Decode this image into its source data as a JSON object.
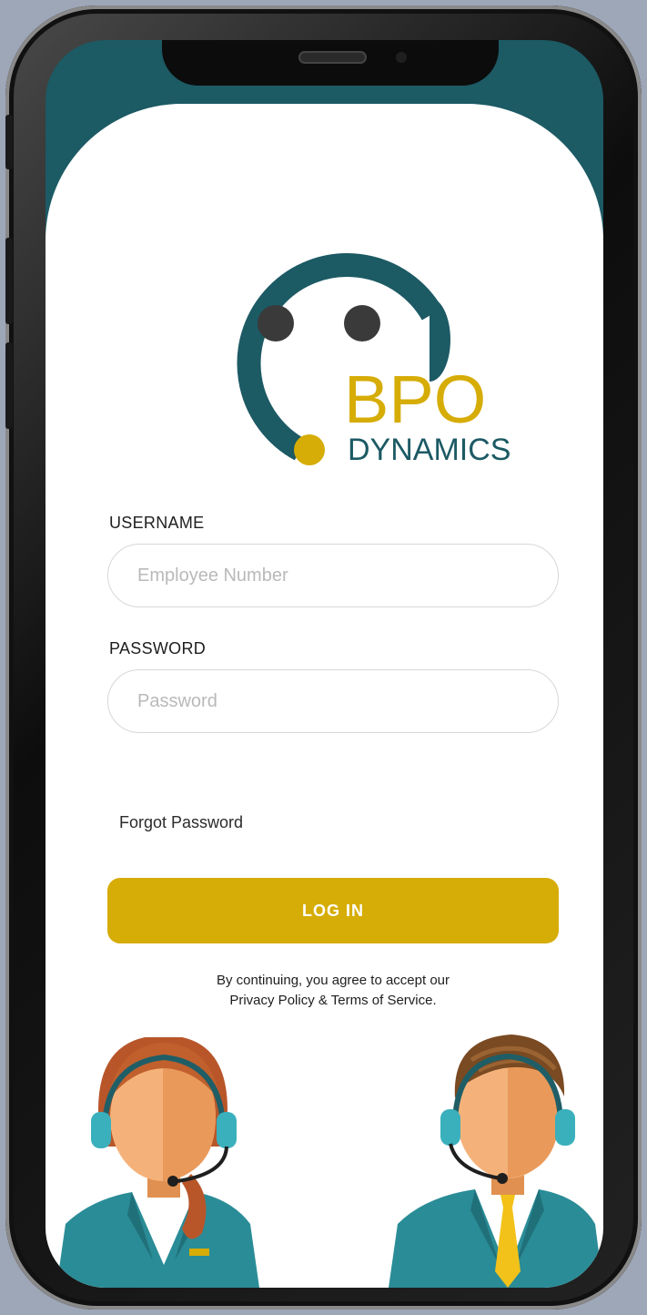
{
  "app": {
    "logo": {
      "brand_line1": "BPO",
      "brand_line2": "DYNAMICS"
    }
  },
  "login": {
    "username_label": "USERNAME",
    "username_placeholder": "Employee Number",
    "password_label": "PASSWORD",
    "password_placeholder": "Password",
    "forgot_password": "Forgot Password",
    "login_button": "LOG IN",
    "terms_line1": "By continuing, you agree to accept our",
    "terms_line2": "Privacy Policy & Terms of Service."
  },
  "colors": {
    "teal": "#1c5a64",
    "gold": "#d6ac06",
    "agent_suit": "#2a8c96",
    "background": "#9ea7b8"
  }
}
